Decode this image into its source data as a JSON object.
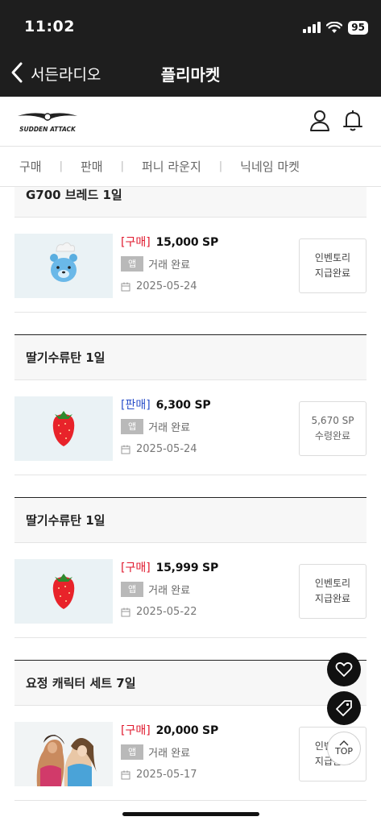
{
  "status_bar": {
    "time": "11:02",
    "battery": "95"
  },
  "nav": {
    "back_label": "서든라디오",
    "title": "플리마켓"
  },
  "site": {
    "logo_text": "SUDDEN ATTACK"
  },
  "tabs": [
    "구매",
    "판매",
    "퍼니 라운지",
    "닉네임 마켓"
  ],
  "cards": [
    {
      "title": "G700 브레드 1일",
      "tag": "[구매]",
      "price": "15,000 SP",
      "badge": "앱",
      "status": "거래 완료",
      "date": "2025-05-24",
      "action_line1": "인벤토리",
      "action_line2": "지급완료",
      "thumb": "bear-icon"
    },
    {
      "title": "딸기수류탄 1일",
      "tag": "[판매]",
      "price": "6,300 SP",
      "badge": "앱",
      "status": "거래 완료",
      "date": "2025-05-24",
      "action_line1": "5,670 SP",
      "action_line2": "수령완료",
      "thumb": "strawberry-icon"
    },
    {
      "title": "딸기수류탄 1일",
      "tag": "[구매]",
      "price": "15,999 SP",
      "badge": "앱",
      "status": "거래 완료",
      "date": "2025-05-22",
      "action_line1": "인벤토리",
      "action_line2": "지급완료",
      "thumb": "strawberry-icon"
    },
    {
      "title": "요정 캐릭터 세트 7일",
      "tag": "[구매]",
      "price": "20,000 SP",
      "badge": "앱",
      "status": "거래 완료",
      "date": "2025-05-17",
      "action_line1": "인벤토리",
      "action_line2": "지급완료",
      "thumb": "character-image"
    }
  ],
  "floating": {
    "top_label": "TOP"
  },
  "colors": {
    "buy": "#e0182d",
    "sell": "#2a4fc9",
    "topbar": "#1e1e1e"
  }
}
